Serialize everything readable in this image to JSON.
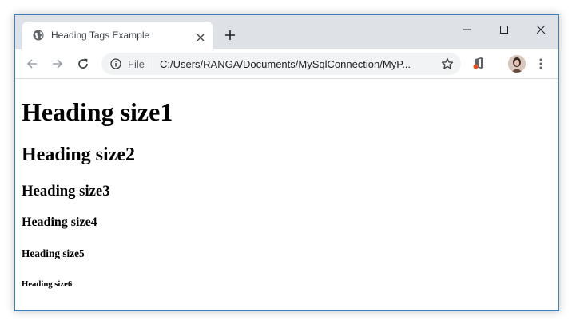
{
  "tab": {
    "title": "Heading Tags Example"
  },
  "address_bar": {
    "scheme_label": "File",
    "url": "C:/Users/RANGA/Documents/MySqlConnection/MyP..."
  },
  "icons": [
    "globe-icon",
    "close-icon",
    "plus-icon",
    "minimize-icon",
    "maximize-icon",
    "back-icon",
    "forward-icon",
    "reload-icon",
    "info-icon",
    "star-icon",
    "office-extension-icon",
    "avatar",
    "kebab-menu-icon"
  ],
  "colors": {
    "titlebar": "#dee1e6",
    "toolbar": "#ffffff",
    "omnibox": "#f1f3f4",
    "accent_border": "#3b7fc4"
  },
  "page": {
    "headings": [
      "Heading size1",
      "Heading size2",
      "Heading size3",
      "Heading size4",
      "Heading size5",
      "Heading size6"
    ]
  }
}
